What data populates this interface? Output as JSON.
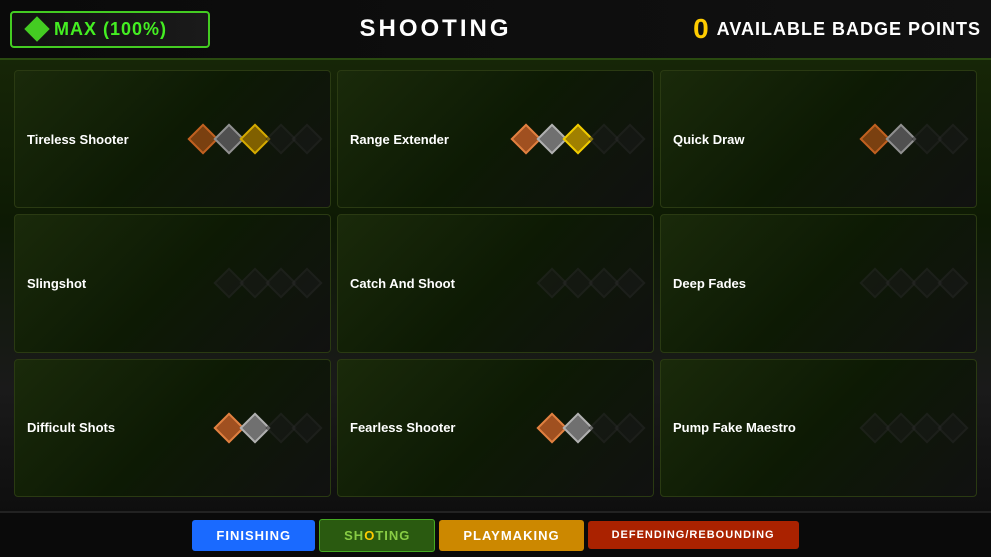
{
  "topBar": {
    "maxLabel": "MAX (100%)",
    "categoryLabel": "SHOOTING",
    "badgeCount": "0",
    "badgePointsLabel": "AVAILABLE BADGE POINTS"
  },
  "badges": [
    {
      "id": "tireless-shooter",
      "name": "Tireless Shooter",
      "icons": [
        "bronze",
        "silver",
        "gold",
        "dim",
        "dim"
      ]
    },
    {
      "id": "range-extender",
      "name": "Range Extender",
      "icons": [
        "active-bronze",
        "active-silver",
        "active-gold",
        "dim",
        "dim"
      ]
    },
    {
      "id": "quick-draw",
      "name": "Quick Draw",
      "icons": [
        "bronze",
        "silver",
        "dim",
        "dim"
      ]
    },
    {
      "id": "slingshot",
      "name": "Slingshot",
      "icons": [
        "dim",
        "dim",
        "dim",
        "dim"
      ]
    },
    {
      "id": "catch-and-shoot",
      "name": "Catch And Shoot",
      "icons": [
        "dim",
        "dim",
        "dim",
        "dim"
      ]
    },
    {
      "id": "deep-fades",
      "name": "Deep Fades",
      "icons": [
        "dim",
        "dim",
        "dim",
        "dim"
      ]
    },
    {
      "id": "difficult-shots",
      "name": "Difficult Shots",
      "icons": [
        "active-bronze",
        "active-silver",
        "dim",
        "dim"
      ]
    },
    {
      "id": "fearless-shooter",
      "name": "Fearless Shooter",
      "icons": [
        "active-bronze",
        "active-silver",
        "dim",
        "dim"
      ]
    },
    {
      "id": "pump-fake-maestro",
      "name": "Pump Fake Maestro",
      "icons": [
        "dim",
        "dim",
        "dim",
        "dim"
      ]
    }
  ],
  "tabs": [
    {
      "id": "finishing",
      "label": "FINISHING",
      "style": "finishing"
    },
    {
      "id": "shooting",
      "label": "SHOOTING",
      "style": "shooting"
    },
    {
      "id": "playmaking",
      "label": "PLAYMAKING",
      "style": "playmaking"
    },
    {
      "id": "defending",
      "label": "DEFENDING/REBOUNDING",
      "style": "defending"
    }
  ]
}
